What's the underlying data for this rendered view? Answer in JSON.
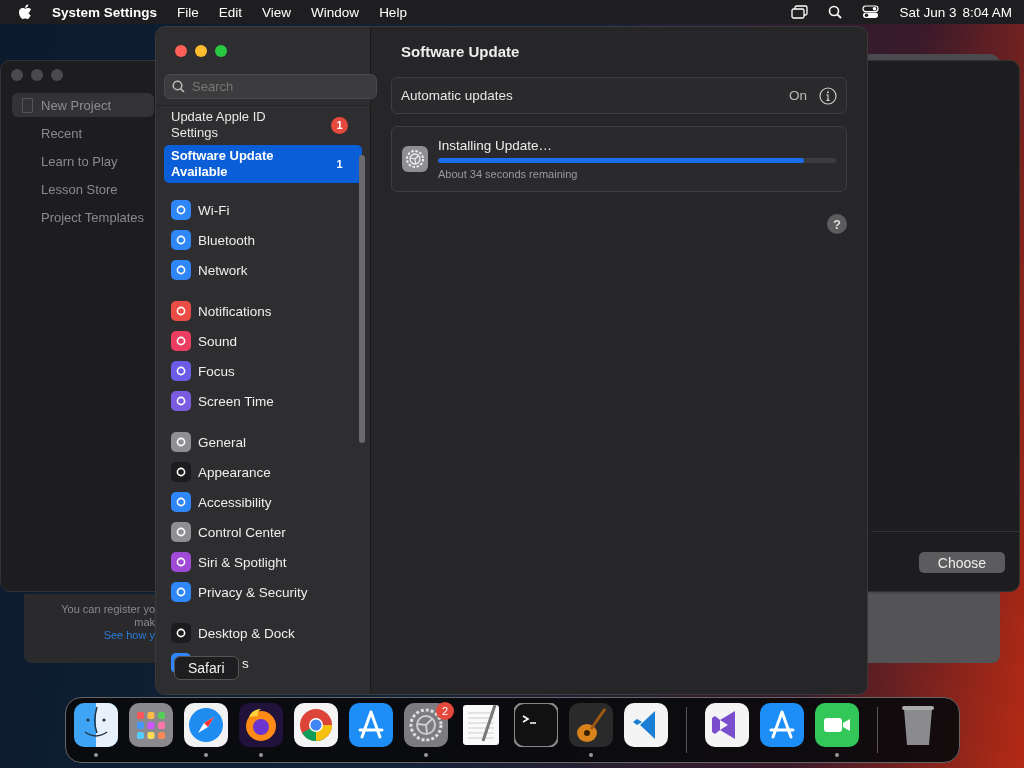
{
  "menu_bar": {
    "app": "System Settings",
    "menus": [
      "File",
      "Edit",
      "View",
      "Window",
      "Help"
    ],
    "date": "Sat Jun 3",
    "time": "8:04 AM"
  },
  "background_window": {
    "sidebar": [
      {
        "label": "New Project",
        "selected": true
      },
      {
        "label": "Recent",
        "selected": false
      },
      {
        "label": "Learn to Play",
        "selected": false
      },
      {
        "label": "Lesson Store",
        "selected": false
      },
      {
        "label": "Project Templates",
        "selected": false
      }
    ],
    "button": "Choose",
    "sheet_lines": [
      {
        "text": "You can register yo",
        "kind": "plain"
      },
      {
        "text": "mak",
        "kind": "plain"
      },
      {
        "text": "See how y",
        "kind": "link"
      }
    ]
  },
  "settings": {
    "search": {
      "placeholder": "Search"
    },
    "sidebar": {
      "groups": [
        [
          {
            "label": "Update Apple ID Settings",
            "kind": "alert",
            "badge": "1",
            "selected": false
          },
          {
            "label": "Software Update Available",
            "kind": "alert",
            "badge": "1",
            "selected": true
          }
        ],
        [
          {
            "label": "Wi-Fi",
            "kind": "item",
            "color": "#2f86f6",
            "selected": false
          },
          {
            "label": "Bluetooth",
            "kind": "item",
            "color": "#2f86f6",
            "selected": false
          },
          {
            "label": "Network",
            "kind": "item",
            "color": "#2f86f6",
            "selected": false
          }
        ],
        [
          {
            "label": "Notifications",
            "kind": "item",
            "color": "#eb4d44",
            "selected": false
          },
          {
            "label": "Sound",
            "kind": "item",
            "color": "#eb3d62",
            "selected": false
          },
          {
            "label": "Focus",
            "kind": "item",
            "color": "#6b5ce7",
            "selected": false
          },
          {
            "label": "Screen Time",
            "kind": "item",
            "color": "#7b5ce0",
            "selected": false
          }
        ],
        [
          {
            "label": "General",
            "kind": "item",
            "color": "#8e8e93",
            "selected": false
          },
          {
            "label": "Appearance",
            "kind": "item",
            "color": "#1c1c1e",
            "selected": false
          },
          {
            "label": "Accessibility",
            "kind": "item",
            "color": "#2f86f6",
            "selected": false
          },
          {
            "label": "Control Center",
            "kind": "item",
            "color": "#8e8e93",
            "selected": false
          },
          {
            "label": "Siri & Spotlight",
            "kind": "item",
            "color": "#a04bd8",
            "selected": false
          },
          {
            "label": "Privacy & Security",
            "kind": "item",
            "color": "#2f86f6",
            "selected": false
          }
        ],
        [
          {
            "label": "Desktop & Dock",
            "kind": "item",
            "color": "#1c1c1e",
            "selected": false
          },
          {
            "label": "s",
            "kind": "item",
            "color": "#2f86f6",
            "selected": false
          }
        ]
      ]
    },
    "title": "Software Update",
    "automatic": {
      "label": "Automatic updates",
      "value": "On"
    },
    "update": {
      "title": "Installing Update…",
      "level": 0.92,
      "remaining": "About 34 seconds remaining"
    },
    "help": "?"
  },
  "tooltip": "Safari",
  "dock": {
    "apps": [
      {
        "kind": "finder",
        "running": true
      },
      {
        "kind": "launchpad",
        "running": false
      },
      {
        "kind": "safari",
        "running": true
      },
      {
        "kind": "firefox",
        "running": true
      },
      {
        "kind": "chrome",
        "running": false
      },
      {
        "kind": "appstore",
        "running": false
      },
      {
        "kind": "settings",
        "running": true,
        "badge": "2"
      },
      {
        "kind": "textedit",
        "running": false
      },
      {
        "kind": "terminal",
        "running": false
      },
      {
        "kind": "garageband",
        "running": true
      },
      {
        "kind": "vscode",
        "running": false
      },
      {
        "kind": "divider"
      },
      {
        "kind": "vstudio",
        "running": false
      },
      {
        "kind": "appstore",
        "running": false
      },
      {
        "kind": "facetime",
        "running": true
      },
      {
        "kind": "divider"
      },
      {
        "kind": "trash",
        "running": false
      }
    ]
  }
}
